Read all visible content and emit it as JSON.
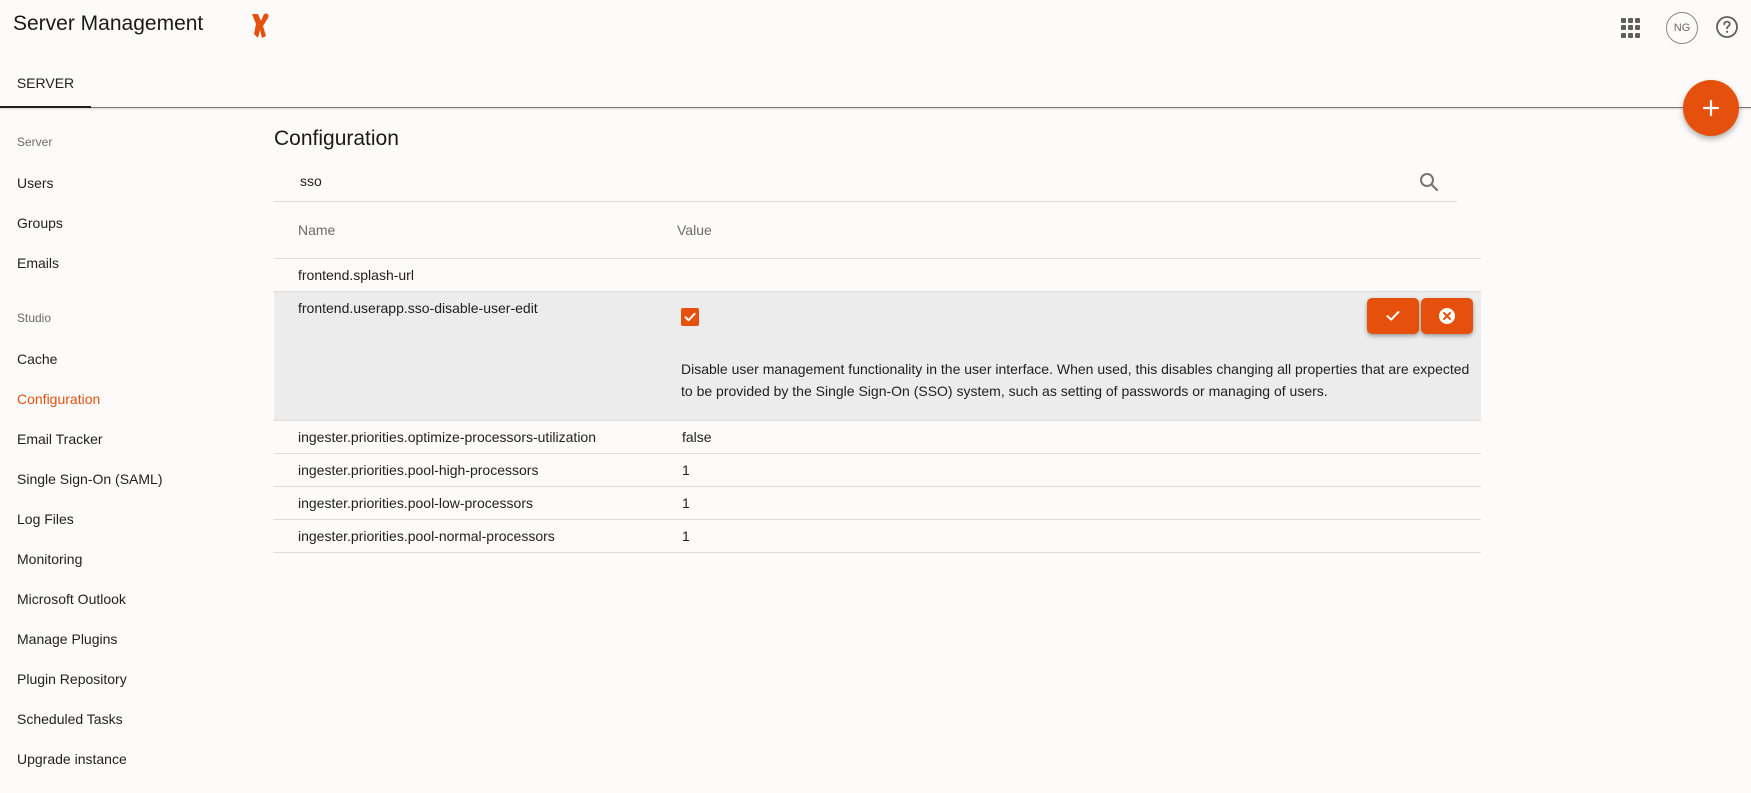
{
  "header": {
    "title": "Server Management",
    "avatar_initials": "NG",
    "icons": [
      "logo-icon",
      "apps-grid-icon",
      "help-icon"
    ]
  },
  "tabs": [
    {
      "label": "SERVER",
      "active": true
    }
  ],
  "fab": {
    "icon": "plus-icon"
  },
  "sidebar": {
    "sections": [
      {
        "label": "Server",
        "items": [
          {
            "label": "Users"
          },
          {
            "label": "Groups"
          },
          {
            "label": "Emails"
          }
        ]
      },
      {
        "label": "Studio",
        "items": [
          {
            "label": "Cache"
          },
          {
            "label": "Configuration",
            "active": true
          },
          {
            "label": "Email Tracker"
          },
          {
            "label": "Single Sign-On (SAML)"
          },
          {
            "label": "Log Files"
          },
          {
            "label": "Monitoring"
          },
          {
            "label": "Microsoft Outlook"
          },
          {
            "label": "Manage Plugins"
          },
          {
            "label": "Plugin Repository"
          },
          {
            "label": "Scheduled Tasks"
          },
          {
            "label": "Upgrade instance"
          }
        ]
      }
    ]
  },
  "main": {
    "title": "Configuration",
    "search": {
      "value": "sso",
      "placeholder": ""
    },
    "columns": {
      "name": "Name",
      "value": "Value"
    },
    "rows": [
      {
        "name": "frontend.splash-url",
        "value": ""
      },
      {
        "name": "frontend.userapp.sso-disable-user-edit",
        "checked": true,
        "description": "Disable user management functionality in the user interface. When used, this disables changing all properties that are expected to be provided by the Single Sign-On (SSO) system, such as setting of passwords or managing of users."
      },
      {
        "name": "ingester.priorities.optimize-processors-utilization",
        "value": "false"
      },
      {
        "name": "ingester.priorities.pool-high-processors",
        "value": "1"
      },
      {
        "name": "ingester.priorities.pool-low-processors",
        "value": "1"
      },
      {
        "name": "ingester.priorities.pool-normal-processors",
        "value": "1"
      }
    ]
  },
  "colors": {
    "accent": "#e5510d",
    "text": "#1f1f1f",
    "muted": "#6b6b6b",
    "editing_row": "#ececec"
  }
}
